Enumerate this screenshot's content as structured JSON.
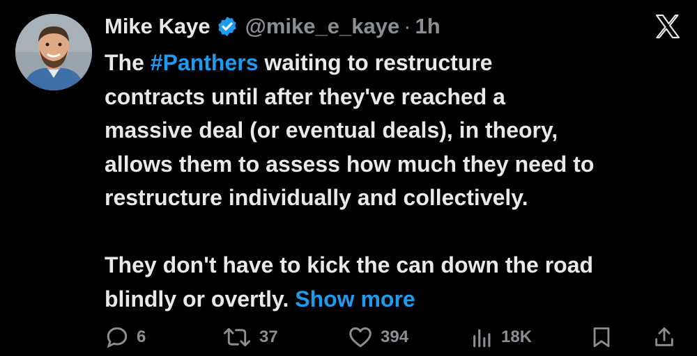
{
  "tweet": {
    "author_name": "Mike Kaye",
    "handle": "@mike_e_kaye",
    "separator": "·",
    "time": "1h",
    "body": {
      "line1_pre": "The ",
      "hashtag": "#Panthers",
      "line1_post": " waiting to restructure",
      "line2": "contracts until after they've reached a",
      "line3": "massive deal (or eventual deals), in theory,",
      "line4": "allows them to assess how much they need to",
      "line5": "restructure individually and collectively.",
      "line6": "They don't have to kick the can down the road",
      "line7_pre": "blindly or overtly. ",
      "show_more": "Show more"
    },
    "actions": {
      "replies": "6",
      "retweets": "37",
      "likes": "394",
      "views": "18K"
    }
  },
  "icons": {
    "verified": "verified-badge-icon",
    "logo": "x-logo-icon",
    "reply": "reply-icon",
    "retweet": "retweet-icon",
    "like": "heart-icon",
    "views": "views-icon",
    "bookmark": "bookmark-icon",
    "share": "share-icon"
  },
  "colors": {
    "background": "#000000",
    "text": "#e7e9ea",
    "secondary": "#8b8f94",
    "accent": "#1d9bf0"
  }
}
